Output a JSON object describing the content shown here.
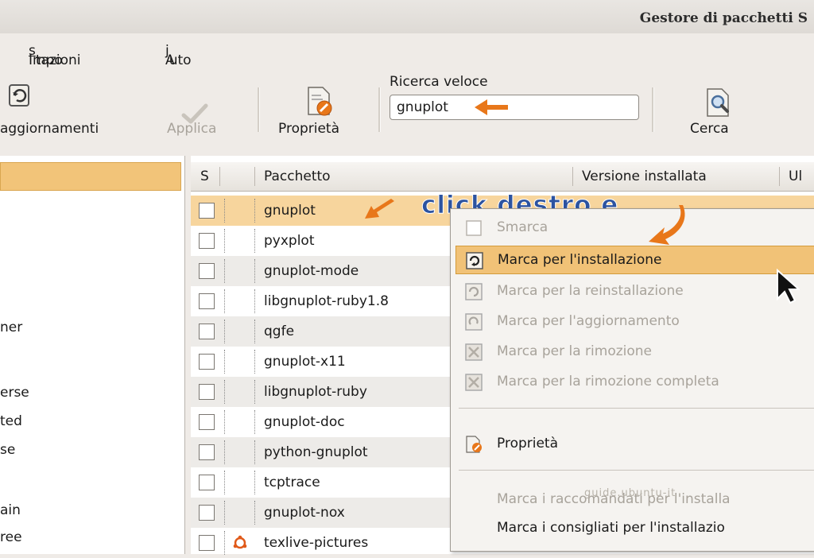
{
  "window": {
    "title": "Gestore di pacchetti S"
  },
  "menubar": {
    "items": [
      {
        "pre": "Impo",
        "mnemonic": "s",
        "post": "tazioni"
      },
      {
        "pre": "A",
        "mnemonic": "j",
        "post": "uto"
      }
    ]
  },
  "toolbar": {
    "update_label": "aggiornamenti",
    "apply_label": "Applica",
    "properties_label": "Proprietà",
    "search_label": "Ricerca veloce",
    "search_value": "gnuplot",
    "find_label": "Cerca"
  },
  "left_panel": {
    "items": [
      "ner",
      "erse",
      "ted",
      "se",
      "ain",
      "ree"
    ]
  },
  "table": {
    "headers": {
      "status": "S",
      "package": "Pacchetto",
      "installed_version": "Versione installata",
      "latest": "Ul"
    },
    "rows": [
      "gnuplot",
      "pyxplot",
      "gnuplot-mode",
      "libgnuplot-ruby1.8",
      "qgfe",
      "gnuplot-x11",
      "libgnuplot-ruby",
      "gnuplot-doc",
      "python-gnuplot",
      "tcptrace",
      "gnuplot-nox",
      "texlive-pictures"
    ]
  },
  "context_menu": {
    "items": {
      "unmark": "Smarca",
      "mark_install": "Marca per l'installazione",
      "mark_reinstall": "Marca per la reinstallazione",
      "mark_upgrade": "Marca per l'aggiornamento",
      "mark_remove": "Marca per la rimozione",
      "mark_purge": "Marca per la rimozione completa",
      "properties": "Proprietà",
      "mark_recommended": "Marca i raccomandati per l'installa",
      "mark_suggested": "Marca i consigliati per l'installazio"
    },
    "watermark": "guide.ubuntu-it"
  },
  "annotation": {
    "text": "click destro e"
  },
  "colors": {
    "accent": "#f1c277",
    "annotation": "#2c53a0",
    "arrow": "#e8771a"
  }
}
